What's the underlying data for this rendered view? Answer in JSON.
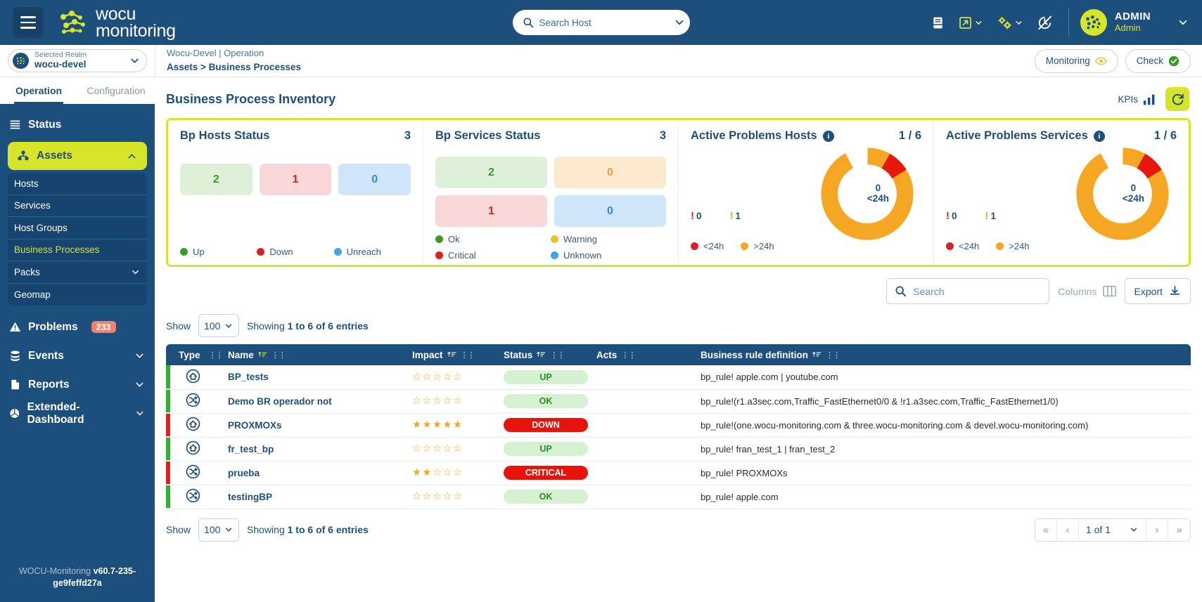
{
  "brand": {
    "name_line1": "wocu",
    "name_line2": "monitoring",
    "accent": "#d7e52a",
    "primary": "#1d4f7c"
  },
  "topbar": {
    "search_placeholder": "Search Host",
    "icons": [
      "book-icon",
      "external-link-icon",
      "gears-icon",
      "clock-off-icon"
    ],
    "user_name": "ADMIN",
    "user_role": "Admin"
  },
  "realm": {
    "label": "Selected Realm",
    "value": "wocu-devel"
  },
  "breadcrumb": {
    "line1": "Wocu-Devel | Operation",
    "line2": "Assets > Business Processes"
  },
  "top_actions": {
    "monitoring": "Monitoring",
    "check": "Check"
  },
  "nav_tabs": [
    {
      "label": "Operation",
      "active": true
    },
    {
      "label": "Configuration",
      "active": false
    }
  ],
  "sidebar": {
    "items": [
      {
        "label": "Status",
        "icon": "status-icon",
        "type": "item"
      },
      {
        "label": "Assets",
        "icon": "assets-icon",
        "type": "pill",
        "expanded": true
      },
      {
        "label": "Problems",
        "icon": "warning-icon",
        "type": "item",
        "badge": "233"
      },
      {
        "label": "Events",
        "icon": "events-icon",
        "type": "item",
        "caret": true
      },
      {
        "label": "Reports",
        "icon": "reports-icon",
        "type": "item",
        "caret": true
      },
      {
        "label": "Extended-Dashboard",
        "icon": "dashboard-icon",
        "type": "item",
        "caret": true
      }
    ],
    "assets_sub": [
      {
        "label": "Hosts",
        "active": false
      },
      {
        "label": "Services",
        "active": false
      },
      {
        "label": "Host Groups",
        "active": false
      },
      {
        "label": "Business Processes",
        "active": true
      },
      {
        "label": "Packs",
        "active": false,
        "caret": true
      },
      {
        "label": "Geomap",
        "active": false
      }
    ],
    "footer_name": "WOCU-Monitoring",
    "footer_version": "v60.7-235-ge9feffd27a"
  },
  "page": {
    "title": "Business Process Inventory",
    "kpis_label": "KPIs"
  },
  "cards": [
    {
      "title": "Bp Hosts Status",
      "count": "3",
      "tiles": [
        {
          "value": "2",
          "bg": "#dff0d8",
          "fg": "#3c9b26"
        },
        {
          "value": "1",
          "bg": "#f8d7d7",
          "fg": "#e02020"
        },
        {
          "value": "0",
          "bg": "#cfe6f8",
          "fg": "#2f8bd6"
        }
      ],
      "legend": [
        {
          "label": "Up",
          "color": "#3c9b26"
        },
        {
          "label": "Down",
          "color": "#e02020"
        },
        {
          "label": "Unreach",
          "color": "#41a4e6"
        }
      ]
    },
    {
      "title": "Bp Services Status",
      "count": "3",
      "tiles": [
        {
          "value": "2",
          "bg": "#dff0d8",
          "fg": "#3c9b26"
        },
        {
          "value": "0",
          "bg": "#fbe8cd",
          "fg": "#e8a33d"
        },
        {
          "value": "1",
          "bg": "#f8d7d7",
          "fg": "#e02020"
        },
        {
          "value": "0",
          "bg": "#cfe6f8",
          "fg": "#2f8bd6"
        }
      ],
      "legend": [
        {
          "label": "Ok",
          "color": "#3c9b26"
        },
        {
          "label": "Warning",
          "color": "#f0c419"
        },
        {
          "label": "Critical",
          "color": "#e02020"
        },
        {
          "label": "Unknown",
          "color": "#41a4e6"
        }
      ]
    }
  ],
  "donut_cards": [
    {
      "title": "Active Problems Hosts",
      "count": "1 / 6",
      "center_value": "0",
      "center_label": "<24h",
      "critical_count": "0",
      "warning_count": "1",
      "legend": [
        {
          "label": "<24h",
          "color": "#e02020"
        },
        {
          "label": ">24h",
          "color": "#f5a623"
        }
      ]
    },
    {
      "title": "Active Problems Services",
      "count": "1 / 6",
      "center_value": "0",
      "center_label": "<24h",
      "critical_count": "0",
      "warning_count": "1",
      "legend": [
        {
          "label": "<24h",
          "color": "#e02020"
        },
        {
          "label": ">24h",
          "color": "#f5a623"
        }
      ]
    }
  ],
  "chart_data": {
    "type": "pie",
    "title": "Active Problems donut",
    "labels": [
      ">24h",
      "<24h"
    ],
    "values": [
      92,
      8
    ],
    "colors": [
      "#f5a623",
      "#e7170c"
    ]
  },
  "toolbar": {
    "search_placeholder": "Search",
    "columns_label": "Columns",
    "export_label": "Export"
  },
  "table_controls": {
    "show_label": "Show",
    "page_size": "100",
    "showing_prefix": "Showing",
    "showing_text": "1 to 6 of 6 entries"
  },
  "table": {
    "headers": [
      "Type",
      "Name",
      "Impact",
      "Status",
      "Acts",
      "Business rule definition"
    ],
    "rows": [
      {
        "bar": "#2fb02f",
        "type_icon": "home-icon",
        "name": "BP_tests",
        "impact": 0,
        "status": "UP",
        "status_bg": "#d6f0d2",
        "status_fg": "#2a8c22",
        "rule": "bp_rule! apple.com | youtube.com"
      },
      {
        "bar": "#2fb02f",
        "type_icon": "shuffle-icon",
        "name": "Demo BR operador not",
        "impact": 0,
        "status": "OK",
        "status_bg": "#d6f0d2",
        "status_fg": "#2a8c22",
        "rule": "bp_rule!(r1.a3sec.com,Traffic_FastEthernet0/0 & !r1.a3sec.com,Traffic_FastEthernet1/0)"
      },
      {
        "bar": "#e02020",
        "type_icon": "home-icon",
        "name": "PROXMOXs",
        "impact": 5,
        "status": "DOWN",
        "status_bg": "#e8130b",
        "status_fg": "#ffffff",
        "rule": "bp_rule!(one.wocu-monitoring.com & three.wocu-monitoring.com & devel.wocu-monitoring.com)"
      },
      {
        "bar": "#2fb02f",
        "type_icon": "home-icon",
        "name": "fr_test_bp",
        "impact": 0,
        "status": "UP",
        "status_bg": "#d6f0d2",
        "status_fg": "#2a8c22",
        "rule": "bp_rule! fran_test_1 | fran_test_2"
      },
      {
        "bar": "#e02020",
        "type_icon": "shuffle-icon",
        "name": "prueba",
        "impact": 2,
        "status": "CRITICAL",
        "status_bg": "#e8130b",
        "status_fg": "#ffffff",
        "rule": "bp_rule! PROXMOXs"
      },
      {
        "bar": "#2fb02f",
        "type_icon": "shuffle-icon",
        "name": "testingBP",
        "impact": 0,
        "status": "OK",
        "status_bg": "#d6f0d2",
        "status_fg": "#2a8c22",
        "rule": "bp_rule! apple.com"
      }
    ]
  },
  "pagination": {
    "page_text": "1 of 1"
  }
}
